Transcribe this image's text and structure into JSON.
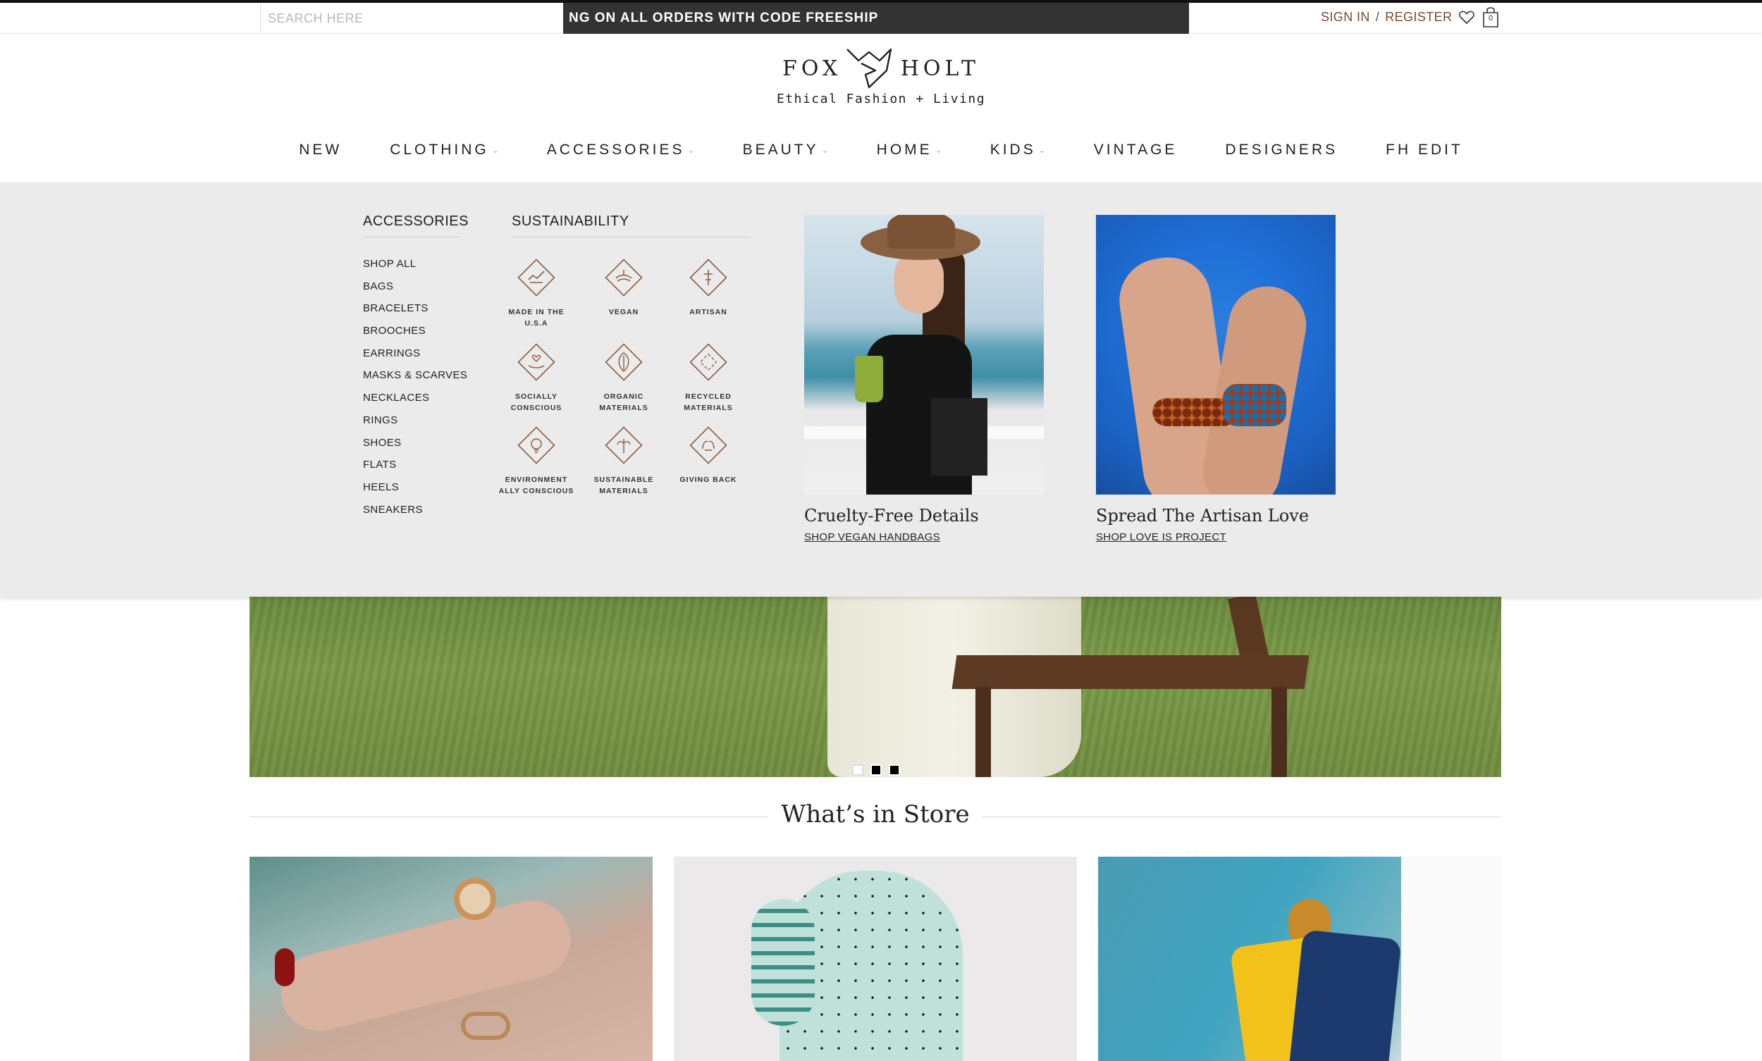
{
  "topbar": {
    "search_placeholder": "SEARCH HERE",
    "promo_text": "NG ON ALL ORDERS WITH CODE FREESHIP",
    "sign_in": "SIGN IN",
    "separator": "/",
    "register": "REGISTER",
    "cart_count": "0"
  },
  "brand": {
    "word_left": "FOX",
    "word_right": "HOLT",
    "tagline": "Ethical Fashion + Living"
  },
  "nav": {
    "items": [
      {
        "label": "NEW",
        "dropdown": false
      },
      {
        "label": "CLOTHING",
        "dropdown": true
      },
      {
        "label": "ACCESSORIES",
        "dropdown": true
      },
      {
        "label": "BEAUTY",
        "dropdown": true
      },
      {
        "label": "HOME",
        "dropdown": true
      },
      {
        "label": "KIDS",
        "dropdown": true
      },
      {
        "label": "VINTAGE",
        "dropdown": false
      },
      {
        "label": "DESIGNERS",
        "dropdown": false
      },
      {
        "label": "FH EDIT",
        "dropdown": false
      }
    ],
    "chevron": "⌄"
  },
  "mega_menu": {
    "accessories_title": "ACCESSORIES",
    "accessories": [
      "SHOP ALL",
      "BAGS",
      "BRACELETS",
      "BROOCHES",
      "EARRINGS",
      "MASKS & SCARVES",
      "NECKLACES",
      "RINGS",
      "SHOES",
      "FLATS",
      "HEELS",
      "SNEAKERS"
    ],
    "sustainability_title": "SUSTAINABILITY",
    "sustainability": [
      {
        "label": "MADE IN THE U.S.A",
        "icon": "made-in-usa-icon"
      },
      {
        "label": "VEGAN",
        "icon": "vegan-icon"
      },
      {
        "label": "ARTISAN",
        "icon": "artisan-icon"
      },
      {
        "label": "SOCIALLY CONSCIOUS",
        "icon": "socially-conscious-icon"
      },
      {
        "label": "ORGANIC MATERIALS",
        "icon": "organic-materials-icon"
      },
      {
        "label": "RECYCLED MATERIALS",
        "icon": "recycled-materials-icon"
      },
      {
        "label": "ENVIRONMENT ALLY CONSCIOUS",
        "icon": "environment-icon"
      },
      {
        "label": "SUSTAINABLE MATERIALS",
        "icon": "sustainable-materials-icon"
      },
      {
        "label": "GIVING BACK",
        "icon": "giving-back-icon"
      }
    ],
    "promo_cards": [
      {
        "title": "Cruelty-Free Details",
        "link": "SHOP VEGAN HANDBAGS"
      },
      {
        "title": "Spread The Artisan Love",
        "link": "SHOP LOVE IS PROJECT"
      }
    ]
  },
  "slider": {
    "slide_count": 3,
    "active_index": 0
  },
  "store": {
    "title": "What’s in Store"
  },
  "colors": {
    "promo_bar": "#333333",
    "account_link": "#7a4a2e",
    "badge_icon": "#8a5a3c",
    "mega_bg": "#ebebeb"
  }
}
